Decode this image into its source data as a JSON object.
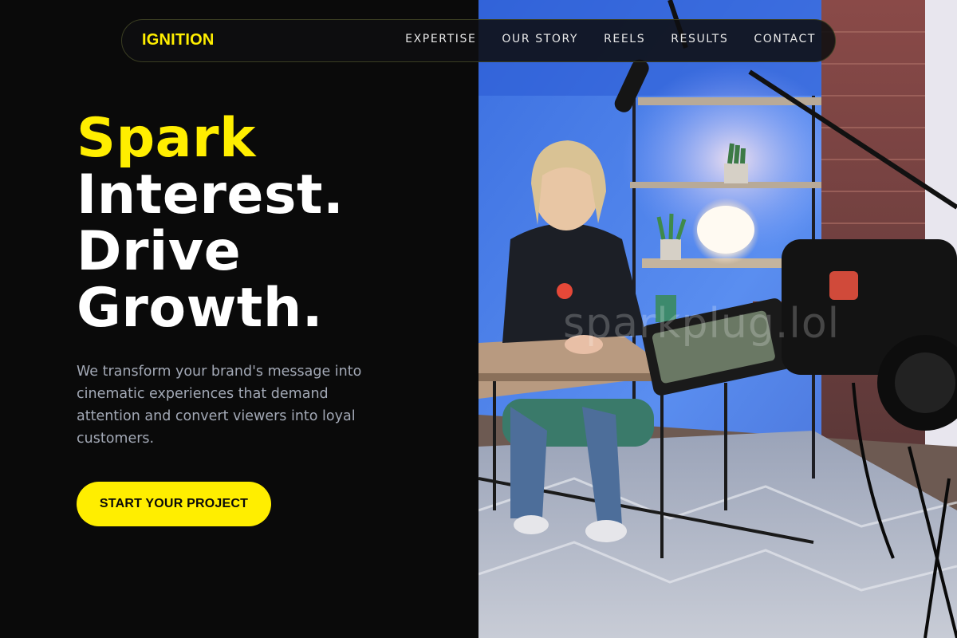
{
  "nav": {
    "logo": "IGNITION",
    "links": [
      "EXPERTISE",
      "OUR STORY",
      "REELS",
      "RESULTS",
      "CONTACT"
    ]
  },
  "hero": {
    "headline_accent": "Spark",
    "headline_lines": [
      "Interest.",
      "Drive",
      "Growth."
    ],
    "description": "We transform your brand's message into cinematic experiences that demand attention and convert viewers into loyal customers.",
    "cta_label": "START YOUR PROJECT"
  },
  "photo": {
    "watermark": "sparkplug.lol"
  },
  "colors": {
    "accent": "#ffee00",
    "background": "#0a0a0a",
    "text": "#ffffff",
    "muted": "#a3a9b6"
  }
}
